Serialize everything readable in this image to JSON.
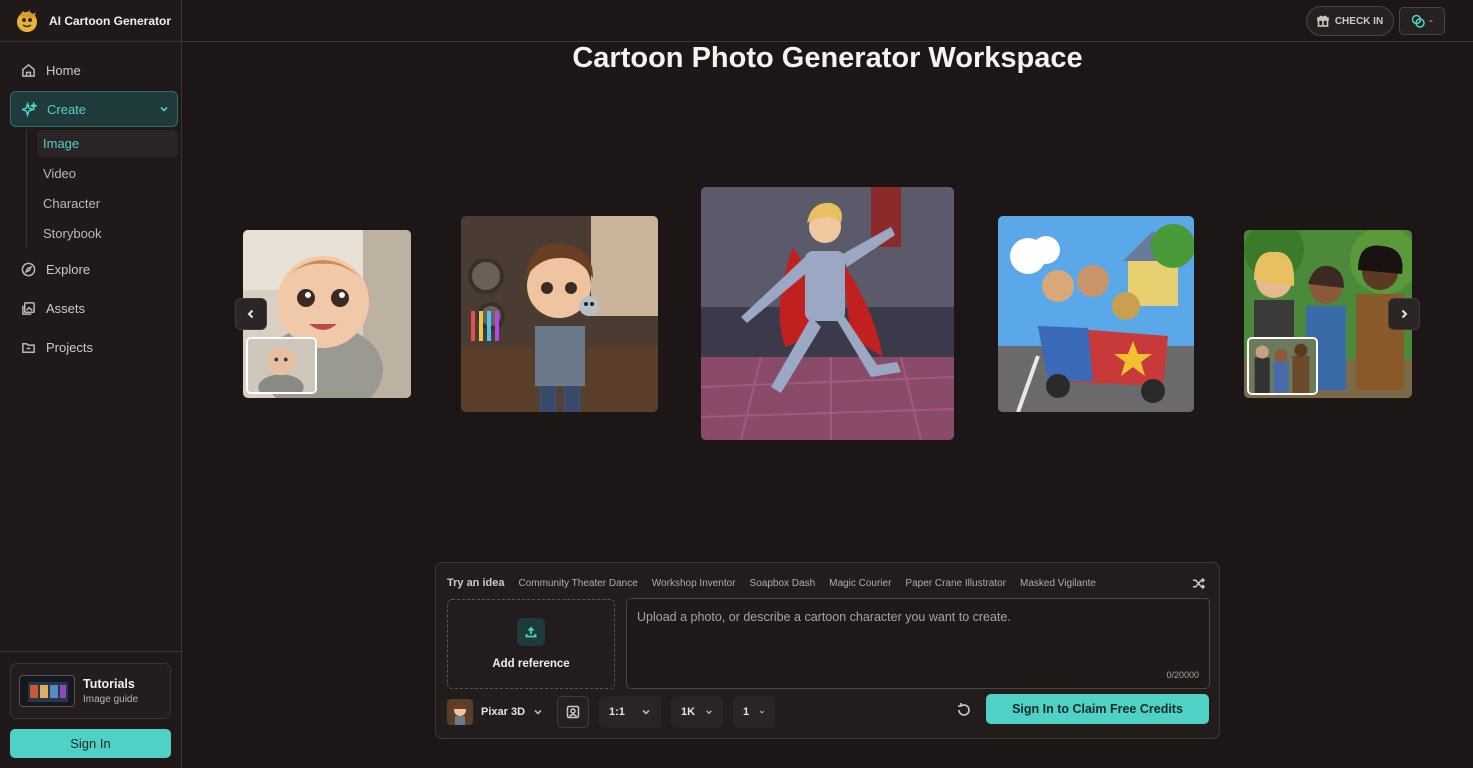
{
  "app": {
    "name": "AI Cartoon Generator"
  },
  "sidebar": {
    "items": [
      {
        "label": "Home",
        "icon": "home-icon"
      },
      {
        "label": "Create",
        "icon": "sparkle-icon"
      },
      {
        "label": "Explore",
        "icon": "compass-icon"
      },
      {
        "label": "Assets",
        "icon": "gallery-icon"
      },
      {
        "label": "Projects",
        "icon": "folder-icon"
      }
    ],
    "create_sub": [
      "Image",
      "Video",
      "Character",
      "Storybook"
    ],
    "tutorial": {
      "title": "Tutorials",
      "subtitle": "Image guide"
    },
    "signin_label": "Sign In"
  },
  "topbar": {
    "checkin_label": "CHECK IN",
    "credits_value": "-"
  },
  "main": {
    "title": "Cartoon Photo Generator Workspace",
    "carousel": [
      "baby-cartoon-image",
      "boy-inventor-image",
      "prince-dancing-image",
      "soapbox-race-image",
      "friends-group-image"
    ]
  },
  "prompt": {
    "ideas_label": "Try an idea",
    "ideas": [
      "Community Theater Dance",
      "Workshop Inventor",
      "Soapbox Dash",
      "Magic Courier",
      "Paper Crane Illustrator",
      "Masked Vigilante"
    ],
    "reference_label": "Add reference",
    "placeholder": "Upload a photo, or describe a cartoon character you want to create.",
    "counter": "0/20000",
    "style": "Pixar 3D",
    "ratio": "1:1",
    "resolution": "1K",
    "count": "1",
    "claim_label": "Sign In to Claim Free Credits"
  },
  "colors": {
    "accent": "#4fd1c5",
    "background": "#1c1716"
  }
}
